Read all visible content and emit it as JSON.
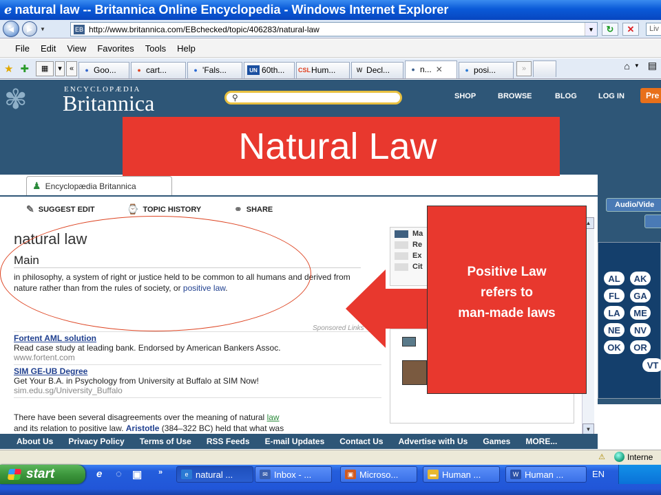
{
  "window": {
    "title": "natural law -- Britannica Online Encyclopedia - Windows Internet Explorer"
  },
  "address": {
    "url": "http://www.britannica.com/EBchecked/topic/406283/natural-law",
    "live_search": "Liv"
  },
  "menu": [
    "File",
    "Edit",
    "View",
    "Favorites",
    "Tools",
    "Help"
  ],
  "tabs": [
    {
      "label": "Goo...",
      "icon": "google-icon",
      "color": "#3366cc"
    },
    {
      "label": "cart...",
      "icon": "google-icon",
      "color": "#dd4422"
    },
    {
      "label": "'Fals...",
      "icon": "ie-icon",
      "color": "#2a6ad4"
    },
    {
      "label": "60th...",
      "icon": "un-icon",
      "color": "#1a4fa0",
      "glyph": "UN"
    },
    {
      "label": "Hum...",
      "icon": "csl-icon",
      "color": "#e04020",
      "glyph": "CSL"
    },
    {
      "label": "Decl...",
      "icon": "wikipedia-icon",
      "color": "#444444",
      "glyph": "W"
    },
    {
      "label": "n...",
      "icon": "britannica-icon",
      "color": "#3b5f8c",
      "active": true
    },
    {
      "label": "posi...",
      "icon": "circle-icon",
      "color": "#2a7ad4"
    }
  ],
  "britannica": {
    "logo_small": "ENCYCLOPÆDIA",
    "logo_big": "Britannica",
    "nav": [
      "SHOP",
      "BROWSE",
      "BLOG",
      "LOG IN"
    ],
    "premium": "Pre",
    "eb_tab": "Encyclopædia Britannica",
    "tools": [
      "SUGGEST EDIT",
      "TOPIC HISTORY",
      "SHARE"
    ],
    "heading": "natural law",
    "subheading": "Main",
    "para_text": "in philosophy, a system of right or justice held to be common to all humans and derived from nature rather than from the rules of society, or ",
    "para_link": "positive law",
    "para_end": ".",
    "sponsored": "Sponsored Links",
    "ads": [
      {
        "title": "Fortent AML solution",
        "desc": "Read case study at leading bank. Endorsed by American Bankers Assoc.",
        "url": "www.fortent.com"
      },
      {
        "title": "SIM GE-UB Degree",
        "desc": "Get Your B.A. in Psychology from University at Buffalo at SIM Now!",
        "url": "sim.edu.sg/University_Buffalo"
      }
    ],
    "para2_a": "There have been several disagreements over the meaning of natural ",
    "para2_link": "law",
    "para2_b": "and its relation to positive law. ",
    "para2_bold": "Aristotle",
    "para2_c": " (384–322 BC) held that what was",
    "side_items": [
      "Ma",
      "Re",
      "Ex",
      "Cit"
    ],
    "audio": "Audio/Vide",
    "states": [
      "AL",
      "AK",
      "FL",
      "GA",
      "LA",
      "ME",
      "NE",
      "NV",
      "OK",
      "OR",
      "VT"
    ],
    "footer": [
      "About Us",
      "Privacy Policy",
      "Terms of Use",
      "RSS Feeds",
      "E-mail Updates",
      "Contact Us",
      "Advertise with Us",
      "Games",
      "MORE..."
    ]
  },
  "overlay": {
    "title": "Natural Law",
    "callout_lines": [
      "Positive Law",
      "refers to",
      "man-made laws"
    ],
    "color": "#e8382e"
  },
  "status": {
    "zone": "Interne"
  },
  "taskbar": {
    "start": "start",
    "tasks": [
      {
        "label": "natural ...",
        "icon": "ie-icon",
        "active": true
      },
      {
        "label": "Inbox - ...",
        "icon": "mail-icon"
      },
      {
        "label": "Microso...",
        "icon": "office-icon"
      },
      {
        "label": "Human ...",
        "icon": "folder-icon"
      },
      {
        "label": "Human ...",
        "icon": "word-icon"
      }
    ],
    "lang": "EN"
  }
}
